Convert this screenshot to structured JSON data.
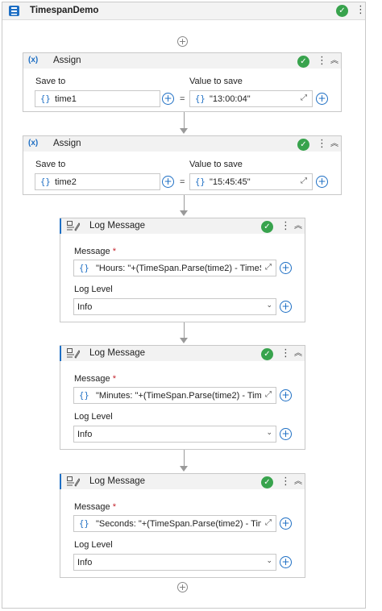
{
  "sequence": {
    "title": "TimespanDemo",
    "status_icon": "check-circle-icon",
    "menu_icon": "kebab-icon"
  },
  "activities": [
    {
      "type": "Assign",
      "title": "Assign",
      "save_to_label": "Save to",
      "value_label": "Value to save",
      "save_to_value": "time1",
      "value_to_save": "\"13:00:04\"",
      "equals": "="
    },
    {
      "type": "Assign",
      "title": "Assign",
      "save_to_label": "Save to",
      "value_label": "Value to save",
      "save_to_value": "time2",
      "value_to_save": "\"15:45:45\"",
      "equals": "="
    },
    {
      "type": "LogMessage",
      "title": "Log Message",
      "message_label": "Message",
      "required_mark": "*",
      "message_value": "\"Hours: \"+(TimeSpan.Parse(time2) - TimeS",
      "log_level_label": "Log Level",
      "log_level_value": "Info"
    },
    {
      "type": "LogMessage",
      "title": "Log Message",
      "message_label": "Message",
      "required_mark": "*",
      "message_value": "\"Minutes: \"+(TimeSpan.Parse(time2) - Time",
      "log_level_label": "Log Level",
      "log_level_value": "Info"
    },
    {
      "type": "LogMessage",
      "title": "Log Message",
      "message_label": "Message",
      "required_mark": "*",
      "message_value": "\"Seconds: \"+(TimeSpan.Parse(time2) - Tim",
      "log_level_label": "Log Level",
      "log_level_value": "Info"
    }
  ],
  "glyphs": {
    "braces": "{}",
    "check": "✓",
    "kebab": "⋮",
    "collapse": "︽",
    "plus": "+",
    "expand": "⤢",
    "chevron": "⌄",
    "assign_icon": "(x)"
  },
  "colors": {
    "accent": "#1e6fc4",
    "success": "#38a34d",
    "required": "#c4262e"
  }
}
